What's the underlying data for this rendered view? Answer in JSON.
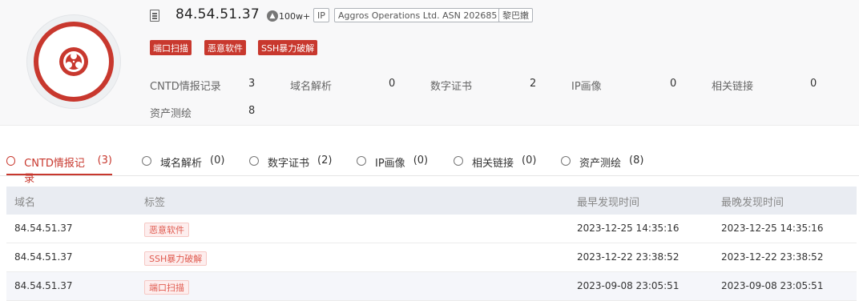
{
  "header": {
    "ip": "84.54.51.37",
    "popularity": "100w+",
    "type_tag": "IP",
    "asn_tag": "Aggros Operations Ltd. ASN 202685",
    "location_tag": "黎巴嫩",
    "threat_tags": [
      "端口扫描",
      "恶意软件",
      "SSH暴力破解"
    ]
  },
  "stats": [
    {
      "label": "CNTD情报记录",
      "value": "3"
    },
    {
      "label": "域名解析",
      "value": "0"
    },
    {
      "label": "数字证书",
      "value": "2"
    },
    {
      "label": "IP画像",
      "value": "0"
    },
    {
      "label": "相关链接",
      "value": "0"
    },
    {
      "label": "资产测绘",
      "value": "8"
    }
  ],
  "tabs": [
    {
      "label": "CNTD情报记录",
      "count": "(3)",
      "icon": "target-icon",
      "active": true
    },
    {
      "label": "域名解析",
      "count": "(0)",
      "icon": "minus-circle-icon"
    },
    {
      "label": "数字证书",
      "count": "(2)",
      "icon": "certificate-icon"
    },
    {
      "label": "IP画像",
      "count": "(0)",
      "icon": "compass-icon"
    },
    {
      "label": "相关链接",
      "count": "(0)",
      "icon": "link-icon"
    },
    {
      "label": "资产测绘",
      "count": "(8)",
      "icon": "compass-icon"
    }
  ],
  "table": {
    "columns": [
      "域名",
      "标签",
      "最早发现时间",
      "最晚发现时间"
    ],
    "rows": [
      {
        "domain": "84.54.51.37",
        "tag": "恶意软件",
        "first_seen": "2023-12-25 14:35:16",
        "last_seen": "2023-12-25 14:35:16"
      },
      {
        "domain": "84.54.51.37",
        "tag": "SSH暴力破解",
        "first_seen": "2023-12-22 23:38:52",
        "last_seen": "2023-12-22 23:38:52"
      },
      {
        "domain": "84.54.51.37",
        "tag": "端口扫描",
        "first_seen": "2023-09-08 23:05:51",
        "last_seen": "2023-09-08 23:05:51"
      }
    ]
  },
  "colors": {
    "accent": "#c8382e",
    "tag_bg": "#fdeeee",
    "header_bg": "#f8f8f9",
    "table_head_bg": "#e9ecf2"
  }
}
